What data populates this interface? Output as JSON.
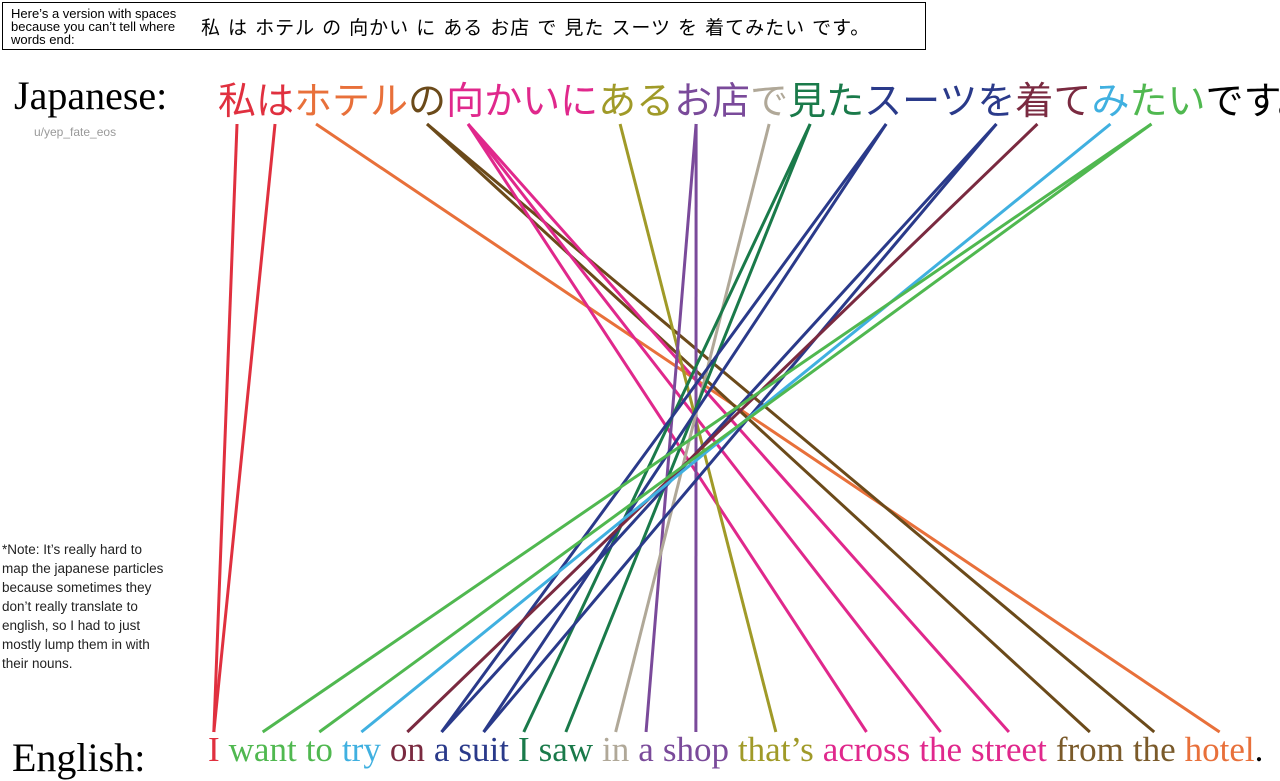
{
  "spaced_version": {
    "label": "Here’s a version with spaces because you can’t tell where words end:",
    "text": "私 は ホテル の 向かい に ある お店 で 見た スーツ を 着てみたい です。"
  },
  "labels": {
    "japanese": "Japanese:",
    "english": "English:"
  },
  "credit": "u/yep_fate_eos",
  "note": "*Note: It’s really hard to map the japanese particles because sometimes they don’t really translate to english, so I had to just mostly lump them in with their nouns.",
  "japanese_segments": [
    {
      "text": "私",
      "color": "#e0303f"
    },
    {
      "text": "は",
      "color": "#e0303f"
    },
    {
      "text": "ホテル",
      "color": "#e8703a"
    },
    {
      "text": "の",
      "color": "#6b4a1a"
    },
    {
      "text": "向かい",
      "color": "#e0288c"
    },
    {
      "text": "に",
      "color": "#e0288c"
    },
    {
      "text": "ある",
      "color": "#a09a28"
    },
    {
      "text": "お店",
      "color": "#7a4a9a"
    },
    {
      "text": "で",
      "color": "#b0a898"
    },
    {
      "text": "見た",
      "color": "#1a7a4a"
    },
    {
      "text": "スーツ",
      "color": "#2a3a8a"
    },
    {
      "text": "を",
      "color": "#2a3a8a"
    },
    {
      "text": "着て",
      "color": "#7a2a40"
    },
    {
      "text": "み",
      "color": "#40b0e0"
    },
    {
      "text": "たい",
      "color": "#50b850"
    },
    {
      "text": "です。",
      "color": "#000000"
    }
  ],
  "english_words": [
    {
      "text": "I",
      "color": "#e0303f"
    },
    {
      "text": "want",
      "color": "#50b850"
    },
    {
      "text": "to",
      "color": "#50b850"
    },
    {
      "text": "try",
      "color": "#40b0e0"
    },
    {
      "text": "on",
      "color": "#7a2a40"
    },
    {
      "text": "a",
      "color": "#2a3a8a"
    },
    {
      "text": "suit",
      "color": "#2a3a8a"
    },
    {
      "text": "I",
      "color": "#1a7a4a"
    },
    {
      "text": "saw",
      "color": "#1a7a4a"
    },
    {
      "text": "in",
      "color": "#b0a898"
    },
    {
      "text": "a",
      "color": "#7a4a9a"
    },
    {
      "text": "shop",
      "color": "#7a4a9a"
    },
    {
      "text": "that’s",
      "color": "#a09a28"
    },
    {
      "text": "across",
      "color": "#e0288c"
    },
    {
      "text": "the",
      "color": "#e0288c"
    },
    {
      "text": "street",
      "color": "#e0288c"
    },
    {
      "text": "from",
      "color": "#7a5a2a"
    },
    {
      "text": "the",
      "color": "#7a5a2a"
    },
    {
      "text": "hotel",
      "color": "#e8703a"
    },
    {
      "text": ".",
      "color": "#000000"
    }
  ],
  "links": [
    [
      0,
      0
    ],
    [
      1,
      0
    ],
    [
      2,
      18
    ],
    [
      3,
      16
    ],
    [
      3,
      17
    ],
    [
      4,
      13
    ],
    [
      4,
      14
    ],
    [
      4,
      15
    ],
    [
      6,
      12
    ],
    [
      7,
      10
    ],
    [
      7,
      11
    ],
    [
      8,
      9
    ],
    [
      9,
      7
    ],
    [
      9,
      8
    ],
    [
      10,
      5
    ],
    [
      10,
      6
    ],
    [
      11,
      5
    ],
    [
      11,
      6
    ],
    [
      12,
      4
    ],
    [
      13,
      3
    ],
    [
      14,
      1
    ],
    [
      14,
      2
    ]
  ]
}
